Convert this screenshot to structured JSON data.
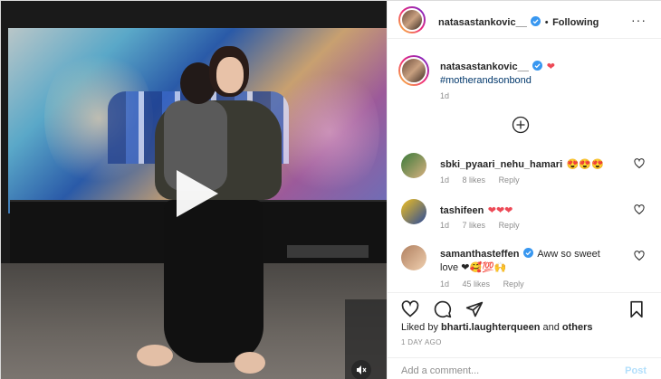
{
  "header": {
    "username": "natasastankovic__",
    "separator": "•",
    "follow_label": "Following",
    "more_label": "···"
  },
  "caption": {
    "username": "natasastankovic__",
    "emoji": "❤",
    "hashtag": "#motherandsonbond",
    "time": "1d"
  },
  "comments": [
    {
      "username": "sbki_pyaari_nehu_hamari",
      "text": "😍😍😍",
      "time": "1d",
      "likes": "8 likes",
      "reply": "Reply"
    },
    {
      "username": "tashifeen",
      "text": "❤❤❤",
      "time": "1d",
      "likes": "7 likes",
      "reply": "Reply"
    },
    {
      "username": "samanthasteffen",
      "text": "Aww so sweet",
      "text2": "love ❤🥰💯🙌",
      "time": "1d",
      "likes": "45 likes",
      "reply": "Reply"
    }
  ],
  "likes": {
    "prefix": "Liked by ",
    "user": "bharti.laughterqueen",
    "middle": " and ",
    "others": "others"
  },
  "post_date": "1 DAY AGO",
  "add_comment": {
    "placeholder": "Add a comment...",
    "post_label": "Post"
  },
  "colors": {
    "text": "#262626",
    "muted": "#8e8e8e",
    "link": "#00376b",
    "verified": "#3897f0",
    "heart": "#ed4956",
    "post_disabled": "#b2dffc"
  },
  "icons": [
    "play-icon",
    "mute-icon",
    "verified-icon",
    "more-icon",
    "plus-circle-icon",
    "heart-icon",
    "comment-icon",
    "share-icon",
    "bookmark-icon"
  ]
}
